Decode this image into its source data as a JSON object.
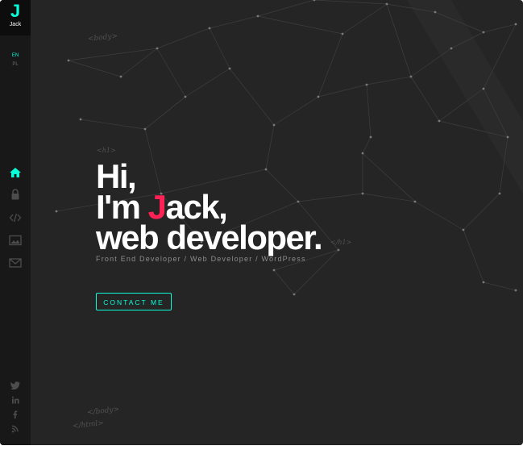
{
  "sidebar": {
    "logo_letter": "J",
    "logo_name": "Jack",
    "languages": [
      "EN",
      "PL"
    ],
    "nav_icons": [
      "home-icon",
      "user-lock-icon",
      "code-icon",
      "image-icon",
      "mail-icon"
    ],
    "social_icons": [
      "twitter-icon",
      "linkedin-icon",
      "facebook-icon",
      "rss-icon"
    ]
  },
  "tags": {
    "body_open": "<body>",
    "h1_open": "<h1>",
    "h1_close": "</h1>",
    "body_close": "</body>",
    "html_close": "</html>"
  },
  "hero": {
    "line1": "Hi,",
    "line2_prefix": "I'm ",
    "line2_j": "J",
    "line2_rest": "ack,",
    "line3": "web developer.",
    "subtitle": "Front End Developer / Web Developer / WordPress",
    "contact_label": "CONTACT ME"
  },
  "colors": {
    "background": "#252526",
    "sidebar": "#181818",
    "accent": "#08fdd8",
    "highlight": "#fd2155"
  }
}
